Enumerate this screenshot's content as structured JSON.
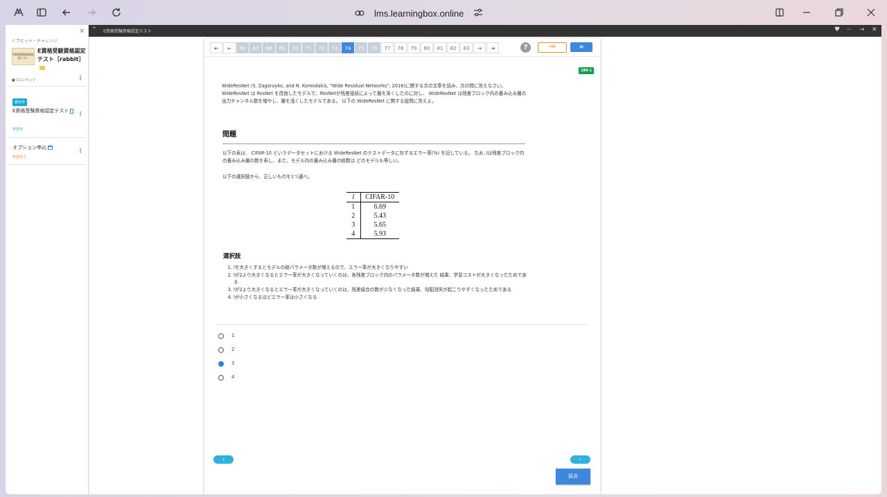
{
  "browser": {
    "url": "lms.learningbox.online"
  },
  "left_panel": {
    "breadcrumb": "くラビット・チャレンジ",
    "thumb_text": "E資格受験資格認定テスト",
    "course_title": "E資格受験資格認定テスト［rabbit］",
    "content_count": "2コンテンツ",
    "current_badge": "表示中",
    "item1_title": "E資格受験資格認定テスト",
    "item1_status": "学習中",
    "item2_title": "オプション申込",
    "item2_status": "学習完了"
  },
  "topbar": {
    "title": "E資格受験資格認定テスト"
  },
  "pager": {
    "pages": [
      "66",
      "67",
      "68",
      "69",
      "70",
      "71",
      "72",
      "73",
      "74",
      "75",
      "76",
      "77",
      "78",
      "79",
      "80",
      "81",
      "82",
      "83"
    ],
    "current": "74",
    "help_label": "?",
    "pause_label": "中断",
    "menu_label": "≡"
  },
  "question": {
    "id": "180-1",
    "intro": "WideResNet (S. Zagoruyko, and N. Komodakis, \"Wide Residual Networks\", 2016)に関する次の文章を読み、次の問に答えなさい。 WideResNet は ResNet を改良したモデルで、ResNetが残差接続によって層を深くしたのに対し、 WideResNet は残差ブロック内の畳み込み層の出力チャンネル数を増やし、層を浅くしたモデルである。 以下の WideResNet に関する設問に答えよ。",
    "heading": "問題",
    "body1": "以下の表は、 CIFAR-10 というデータセットにおける WideResNet のテストデータに対するエラー率(%) を記している。 なお, lは残差ブロック内の畳み込み層の数を表し、また、モデル内の畳み込み層の総数は どのモデルも等しい。",
    "body2": "以下の選択肢から、正しいものを1つ選べ。",
    "table": {
      "col1": "l",
      "col2": "CIFAR-10",
      "rows": [
        [
          "1",
          "6.69"
        ],
        [
          "2",
          "5.43"
        ],
        [
          "3",
          "5.65"
        ],
        [
          "4",
          "5.93"
        ]
      ]
    },
    "choices_heading": "選択肢",
    "choices": [
      "lを大きくするとモデルの総パラメータ数が増えるので、エラー率が大きくなりやすい",
      "lが2より大きくなるとエラー率が大きくなっていくのは、各残差ブロック内のパラメータ数が増えた 結果、学習コストが大きくなったためである",
      "lが2より大きくなるとエラー率が大きくなっていくのは、残差結合の数が少なくなった結果、勾配消失が起こりやすくなったためである",
      "lが小さくなるほどエラー率は小さくなる"
    ],
    "options": [
      "1",
      "2",
      "3",
      "4"
    ],
    "selected": "3"
  },
  "footer": {
    "prev_label": "‹",
    "next_label": "›",
    "grade_label": "採点"
  }
}
